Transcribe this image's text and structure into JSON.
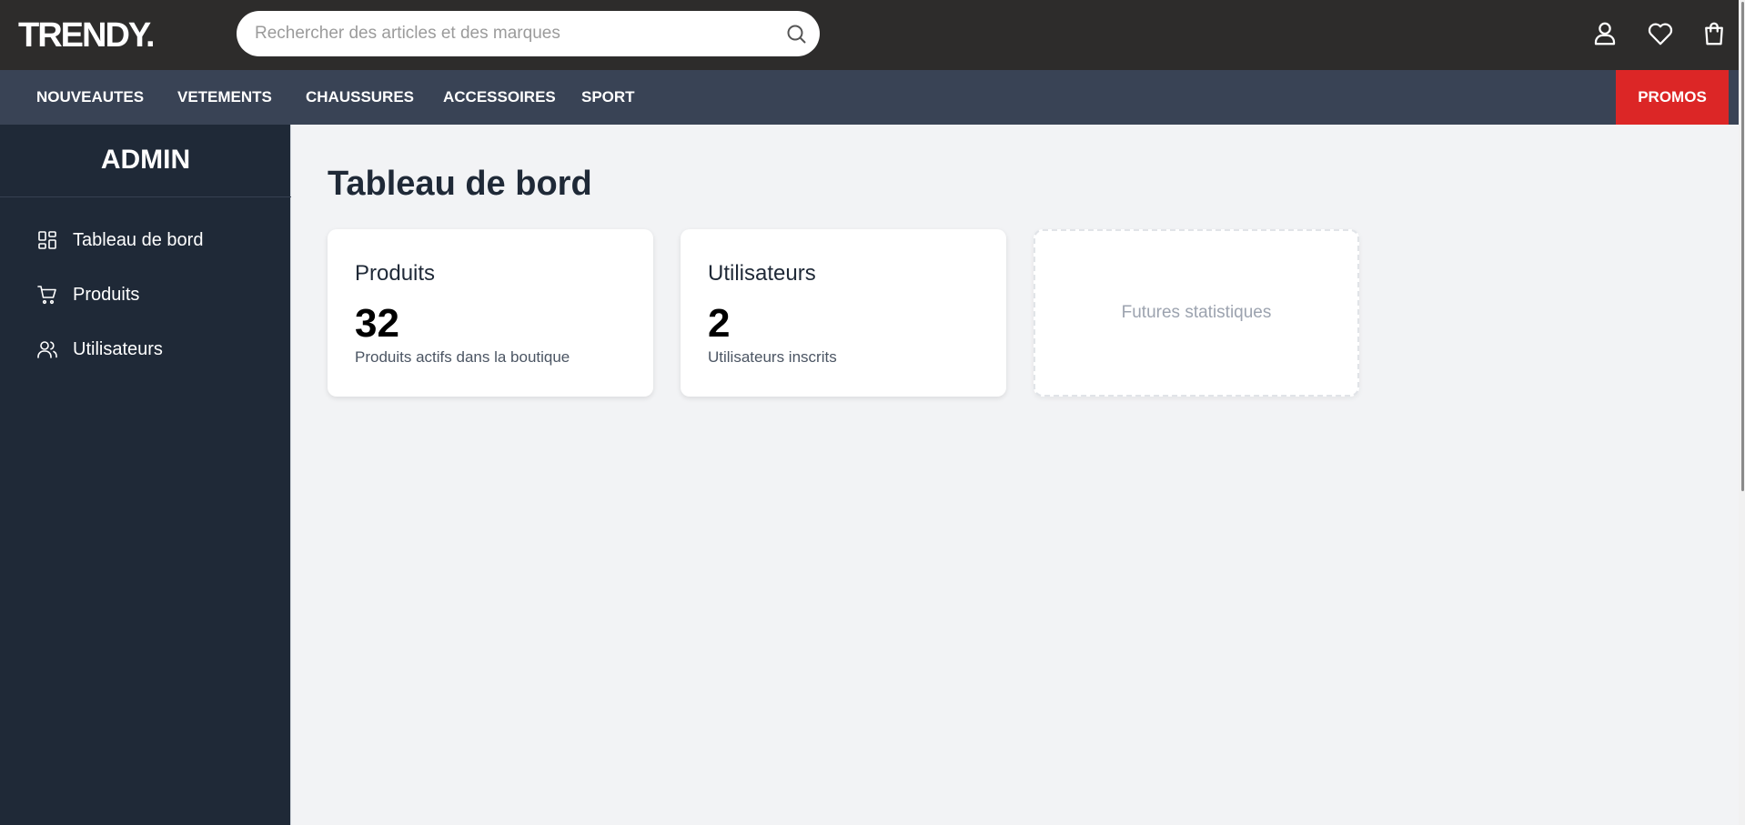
{
  "header": {
    "logo": "TRENDY.",
    "search_placeholder": "Rechercher des articles et des marques",
    "icons": [
      "search-icon",
      "user-icon",
      "heart-icon",
      "shopping-bag-icon"
    ]
  },
  "nav": {
    "items": [
      {
        "label": "NOUVEAUTES"
      },
      {
        "label": "VETEMENTS"
      },
      {
        "label": "CHAUSSURES"
      },
      {
        "label": "ACCESSOIRES"
      },
      {
        "label": "SPORT"
      }
    ],
    "promo_label": "PROMOS"
  },
  "sidebar": {
    "title": "ADMIN",
    "items": [
      {
        "label": "Tableau de bord",
        "icon": "dashboard-icon"
      },
      {
        "label": "Produits",
        "icon": "cart-icon"
      },
      {
        "label": "Utilisateurs",
        "icon": "users-icon"
      }
    ]
  },
  "main": {
    "title": "Tableau de bord",
    "cards": [
      {
        "title": "Produits",
        "value": "32",
        "description": "Produits actifs dans la boutique"
      },
      {
        "title": "Utilisateurs",
        "value": "2",
        "description": "Utilisateurs inscrits"
      }
    ],
    "placeholder_card": "Futures statistiques"
  },
  "colors": {
    "topbar": "#2d2c2b",
    "navbar": "#394355",
    "promo": "#dc2626",
    "sidebar": "#1f2937",
    "content_bg": "#f2f3f5"
  }
}
